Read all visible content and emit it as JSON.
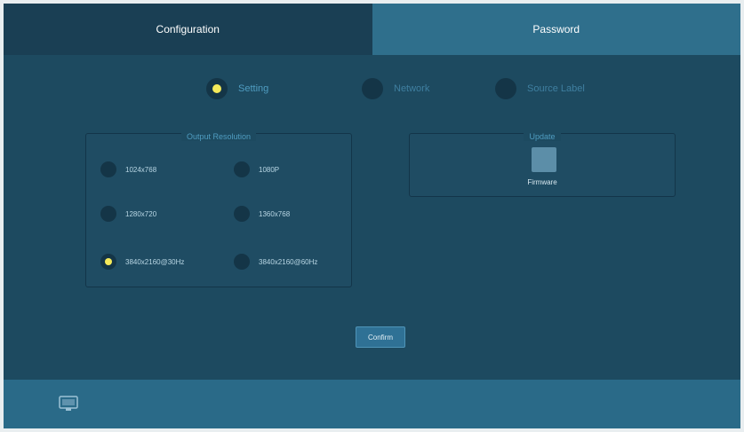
{
  "tabs": [
    {
      "label": "Configuration",
      "active": true
    },
    {
      "label": "Password",
      "active": false
    }
  ],
  "subtabs": [
    {
      "label": "Setting",
      "selected": true
    },
    {
      "label": "Network",
      "selected": false
    },
    {
      "label": "Source Label",
      "selected": false
    }
  ],
  "output_resolution": {
    "title": "Output Resolution",
    "options": [
      {
        "label": "1024x768",
        "selected": false
      },
      {
        "label": "1080P",
        "selected": false
      },
      {
        "label": "1280x720",
        "selected": false
      },
      {
        "label": "1360x768",
        "selected": false
      },
      {
        "label": "3840x2160@30Hz",
        "selected": true
      },
      {
        "label": "3840x2160@60Hz",
        "selected": false
      }
    ]
  },
  "update": {
    "title": "Update",
    "firmware_label": "Firmware"
  },
  "confirm_label": "Confirm",
  "footer": {
    "icon": "display-icon"
  },
  "colors": {
    "background": "#1d4a60",
    "active_tab": "#1a3f54",
    "inactive_tab": "#2f6f8c",
    "selected_dot": "#f5ea5a",
    "accent_text": "#4f9cc0"
  }
}
